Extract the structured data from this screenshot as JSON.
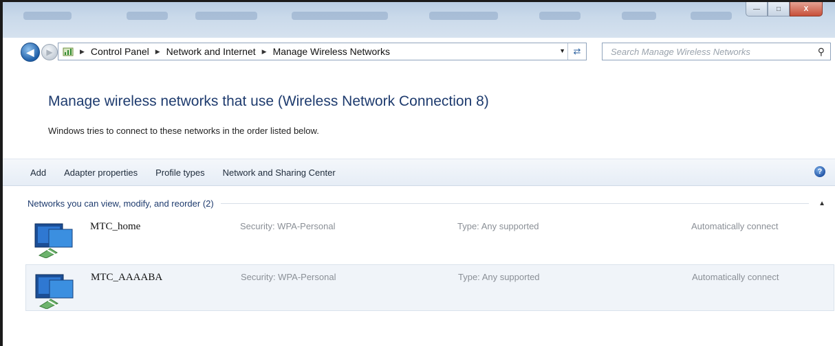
{
  "window": {
    "caption": {
      "minimize": "—",
      "maximize": "□",
      "close": "X"
    }
  },
  "address_bar": {
    "breadcrumbs": [
      "Control Panel",
      "Network and Internet",
      "Manage Wireless Networks"
    ]
  },
  "search": {
    "placeholder": "Search Manage Wireless Networks"
  },
  "main": {
    "heading": "Manage wireless networks that use (Wireless Network Connection 8)",
    "description": "Windows tries to connect to these networks in the order listed below."
  },
  "toolbar": {
    "items": [
      "Add",
      "Adapter properties",
      "Profile types",
      "Network and Sharing Center"
    ],
    "help": "?"
  },
  "group": {
    "label": "Networks you can view, modify, and reorder (2)"
  },
  "networks": [
    {
      "name": "MTC_home",
      "security": "Security:  WPA-Personal",
      "type": "Type:  Any supported",
      "mode": "Automatically connect"
    },
    {
      "name": "MTC_AAAABA",
      "security": "Security:  WPA-Personal",
      "type": "Type:  Any supported",
      "mode": "Automatically connect"
    }
  ],
  "colors": {
    "accent": "#1e3b6e",
    "toolbar_bg": "#e6edf6",
    "selected_row": "#f0f4f9"
  },
  "icons": [
    "back-arrow-icon",
    "forward-arrow-icon",
    "control-panel-icon",
    "refresh-icon",
    "search-icon",
    "help-icon",
    "collapse-icon",
    "wireless-network-icon"
  ]
}
